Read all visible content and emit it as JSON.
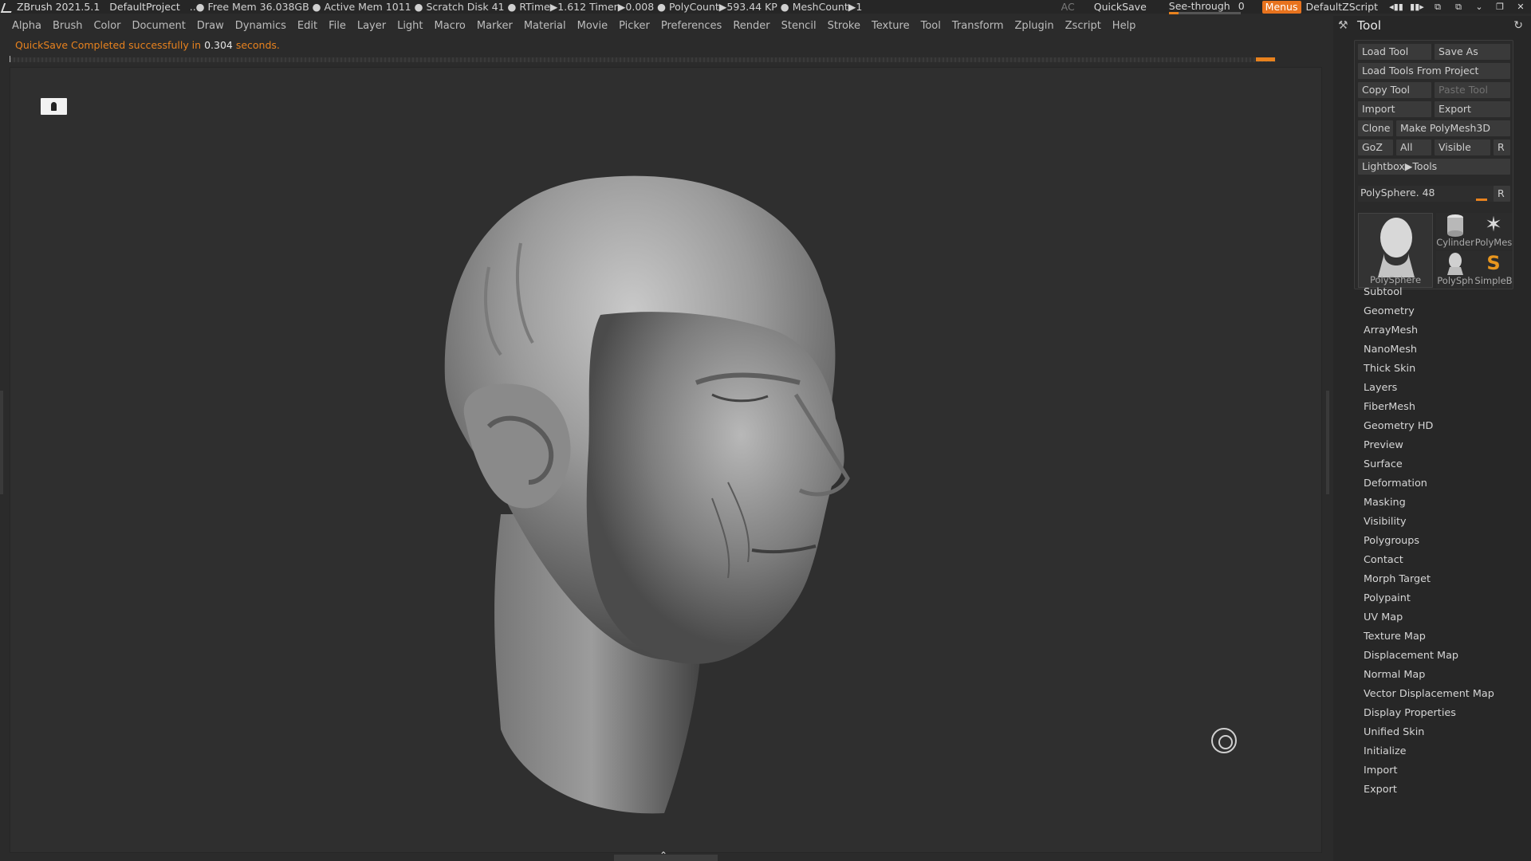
{
  "titlebar": {
    "app": "ZBrush 2021.5.1",
    "project": "DefaultProject",
    "stats": "..● Free Mem 36.038GB ● Active Mem 1011 ● Scratch Disk 41 ●  RTime▶1.612 Timer▶0.008 ● PolyCount▶593.44 KP  ● MeshCount▶1",
    "ac": "AC",
    "quicksave": "QuickSave",
    "see_through_label": "See-through",
    "see_through_value": "0",
    "see_through_level": 0.0,
    "menus": "Menus",
    "zscript": "DefaultZScript",
    "accent": "#e8731e"
  },
  "menubar": {
    "items": [
      "Alpha",
      "Brush",
      "Color",
      "Document",
      "Draw",
      "Dynamics",
      "Edit",
      "File",
      "Layer",
      "Light",
      "Macro",
      "Marker",
      "Material",
      "Movie",
      "Picker",
      "Preferences",
      "Render",
      "Stencil",
      "Stroke",
      "Texture",
      "Tool",
      "Transform",
      "Zplugin",
      "Zscript",
      "Help"
    ]
  },
  "notice": {
    "prefix": "QuickSave Completed successfully in ",
    "value": "0.304",
    "suffix": " seconds."
  },
  "tool_palette": {
    "title": "Tool",
    "buttons": {
      "load_tool": "Load Tool",
      "save_as": "Save As",
      "load_tools_from_project": "Load Tools From Project",
      "copy_tool": "Copy Tool",
      "paste_tool": "Paste Tool",
      "import": "Import",
      "export": "Export",
      "clone": "Clone",
      "make_polymesh3d": "Make PolyMesh3D",
      "goz": "GoZ",
      "all": "All",
      "visible": "Visible",
      "r": "R",
      "lightbox_tools": "Lightbox▶Tools",
      "r2": "R"
    },
    "current_tool": {
      "label": "PolySphere. 48",
      "value": 48
    },
    "thumbnails": {
      "main": "PolySphere",
      "cylinder": "Cylinder",
      "polymesh": "PolyMes",
      "polysph": "PolySph",
      "simpleb": "SimpleB"
    },
    "sections": [
      "Subtool",
      "Geometry",
      "ArrayMesh",
      "NanoMesh",
      "Thick Skin",
      "Layers",
      "FiberMesh",
      "Geometry HD",
      "Preview",
      "Surface",
      "Deformation",
      "Masking",
      "Visibility",
      "Polygroups",
      "Contact",
      "Morph Target",
      "Polypaint",
      "UV Map",
      "Texture Map",
      "Displacement Map",
      "Normal Map",
      "Vector Displacement Map",
      "Display Properties",
      "Unified Skin",
      "Initialize",
      "Import",
      "Export"
    ]
  },
  "icons": {
    "wrench": "wrench-icon",
    "refresh": "refresh-icon",
    "cursor": "brush-cursor-icon",
    "lock": "keyhole-icon"
  }
}
